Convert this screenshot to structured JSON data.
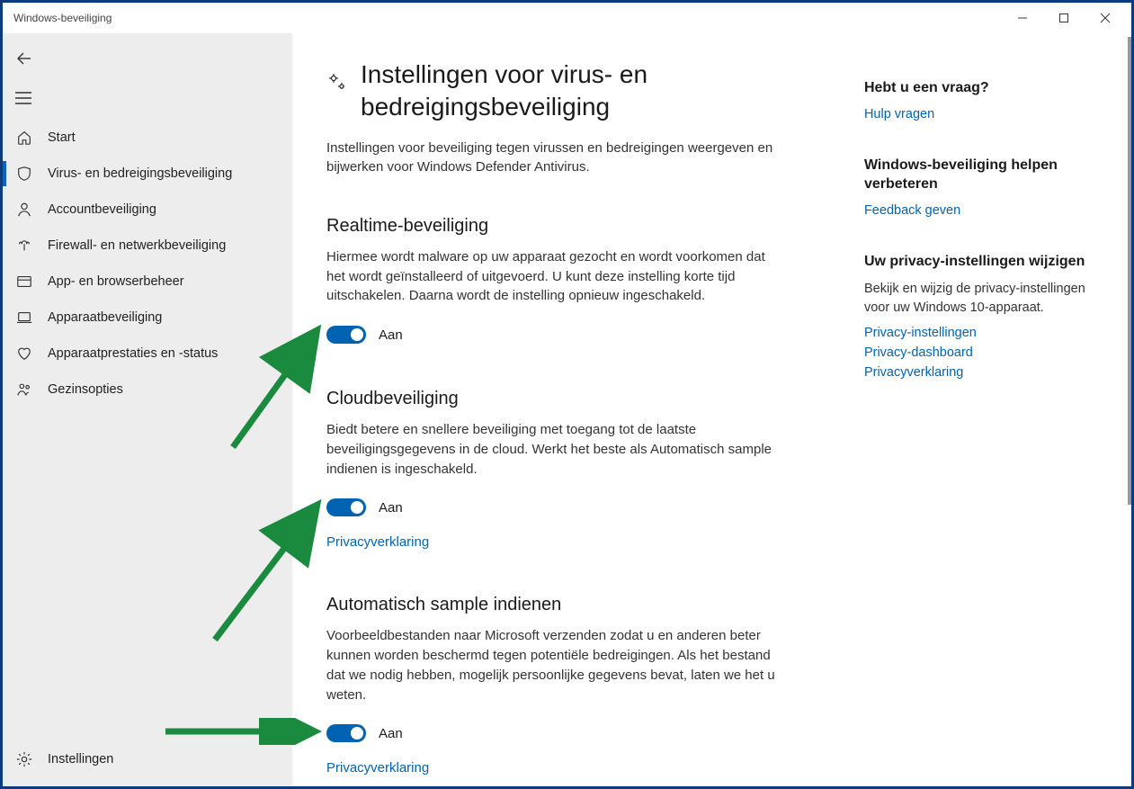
{
  "window": {
    "title": "Windows-beveiliging"
  },
  "sidebar": {
    "items": [
      {
        "icon": "home",
        "label": "Start"
      },
      {
        "icon": "shield",
        "label": "Virus- en bedreigingsbeveiliging",
        "selected": true
      },
      {
        "icon": "person",
        "label": "Accountbeveiliging"
      },
      {
        "icon": "network",
        "label": "Firewall- en netwerkbeveiliging"
      },
      {
        "icon": "browser",
        "label": "App- en browserbeheer"
      },
      {
        "icon": "device",
        "label": "Apparaatbeveiliging"
      },
      {
        "icon": "heart",
        "label": "Apparaatprestaties en -status"
      },
      {
        "icon": "family",
        "label": "Gezinsopties"
      }
    ],
    "settings_label": "Instellingen"
  },
  "page": {
    "title": "Instellingen voor virus- en bedreigingsbeveiliging",
    "subtitle": "Instellingen voor beveiliging tegen virussen en bedreigingen weergeven en bijwerken voor Windows Defender Antivirus."
  },
  "sections": {
    "realtime": {
      "title": "Realtime-beveiliging",
      "desc": "Hiermee wordt malware op uw apparaat gezocht en wordt voorkomen dat het wordt geïnstalleerd of uitgevoerd. U kunt deze instelling korte tijd uitschakelen. Daarna wordt de instelling opnieuw ingeschakeld.",
      "state": "Aan"
    },
    "cloud": {
      "title": "Cloudbeveiliging",
      "desc": "Biedt betere en snellere beveiliging met toegang tot de laatste beveiligingsgegevens in de cloud. Werkt het beste als Automatisch sample indienen is ingeschakeld.",
      "state": "Aan",
      "privacy_link": "Privacyverklaring"
    },
    "sample": {
      "title": "Automatisch sample indienen",
      "desc": "Voorbeeldbestanden naar Microsoft verzenden zodat u en anderen beter kunnen worden beschermd tegen potentiële bedreigingen. Als het bestand dat we nodig hebben, mogelijk persoonlijke gegevens bevat, laten we het u weten.",
      "state": "Aan",
      "privacy_link": "Privacyverklaring"
    }
  },
  "right": {
    "question": {
      "title": "Hebt u een vraag?",
      "link": "Hulp vragen"
    },
    "improve": {
      "title": "Windows-beveiliging helpen verbeteren",
      "link": "Feedback geven"
    },
    "privacy": {
      "title": "Uw privacy-instellingen wijzigen",
      "text": "Bekijk en wijzig de privacy-instellingen voor uw Windows 10-apparaat.",
      "links": [
        "Privacy-instellingen",
        "Privacy-dashboard",
        "Privacyverklaring"
      ]
    }
  },
  "colors": {
    "accent": "#0063b1",
    "arrow": "#1a8a3e"
  }
}
